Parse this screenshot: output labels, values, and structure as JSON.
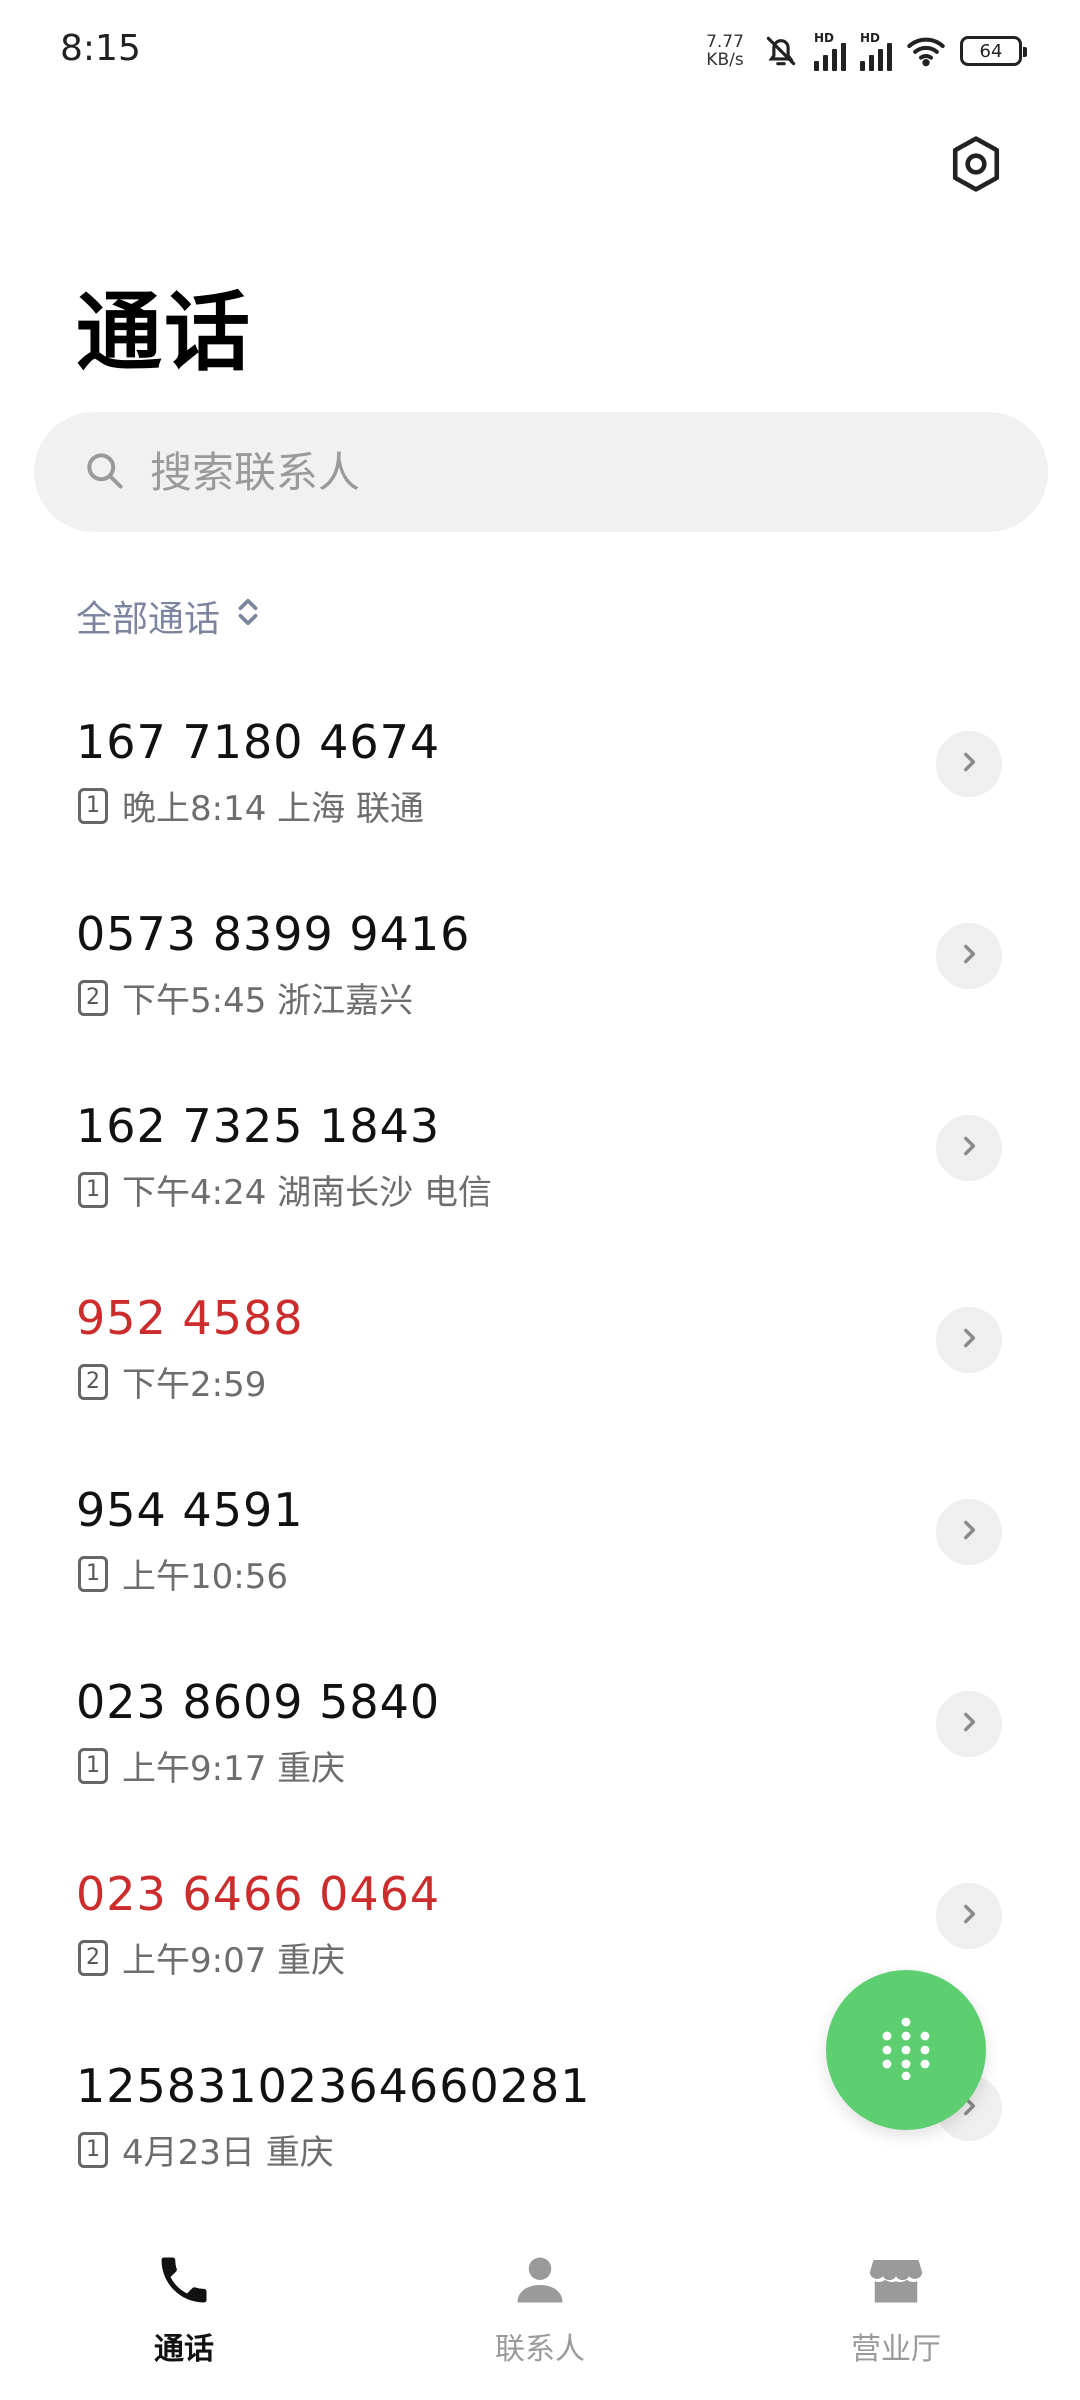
{
  "status_bar": {
    "time": "8:15",
    "net_speed_value": "7.77",
    "net_speed_unit": "KB/s",
    "sim1_label": "HD",
    "sim2_label": "HD",
    "battery": "64"
  },
  "header": {
    "title": "通话"
  },
  "search": {
    "placeholder": "搜索联系人"
  },
  "filter": {
    "label": "全部通话"
  },
  "calls": [
    {
      "number": "167 7180 4674",
      "sim": "1",
      "meta": "晚上8:14 上海 联通",
      "missed": false
    },
    {
      "number": "0573 8399 9416",
      "sim": "2",
      "meta": "下午5:45 浙江嘉兴",
      "missed": false
    },
    {
      "number": "162 7325 1843",
      "sim": "1",
      "meta": "下午4:24 湖南长沙 电信",
      "missed": false
    },
    {
      "number": "952 4588",
      "sim": "2",
      "meta": "下午2:59",
      "missed": true
    },
    {
      "number": "954 4591",
      "sim": "1",
      "meta": "上午10:56",
      "missed": false
    },
    {
      "number": "023 8609 5840",
      "sim": "1",
      "meta": "上午9:17 重庆",
      "missed": false
    },
    {
      "number": "023 6466 0464",
      "sim": "2",
      "meta": "上午9:07 重庆",
      "missed": true
    },
    {
      "number": "12583102364660281",
      "sim": "1",
      "meta": "4月23日 重庆",
      "missed": false
    }
  ],
  "colors": {
    "missed": "#cc2c2c",
    "fab": "#5dcf71",
    "filter": "#7c84a0"
  },
  "bottom_nav": {
    "calls": "通话",
    "contacts": "联系人",
    "service_hall": "营业厅"
  },
  "icons": {
    "settings": "hexagon-gear-icon",
    "search": "search-icon",
    "filter": "up-down-chevron-icon",
    "detail": "chevron-right-icon",
    "dialpad": "dialpad-icon",
    "nav_calls": "phone-icon",
    "nav_contacts": "person-icon",
    "nav_store": "store-icon"
  }
}
